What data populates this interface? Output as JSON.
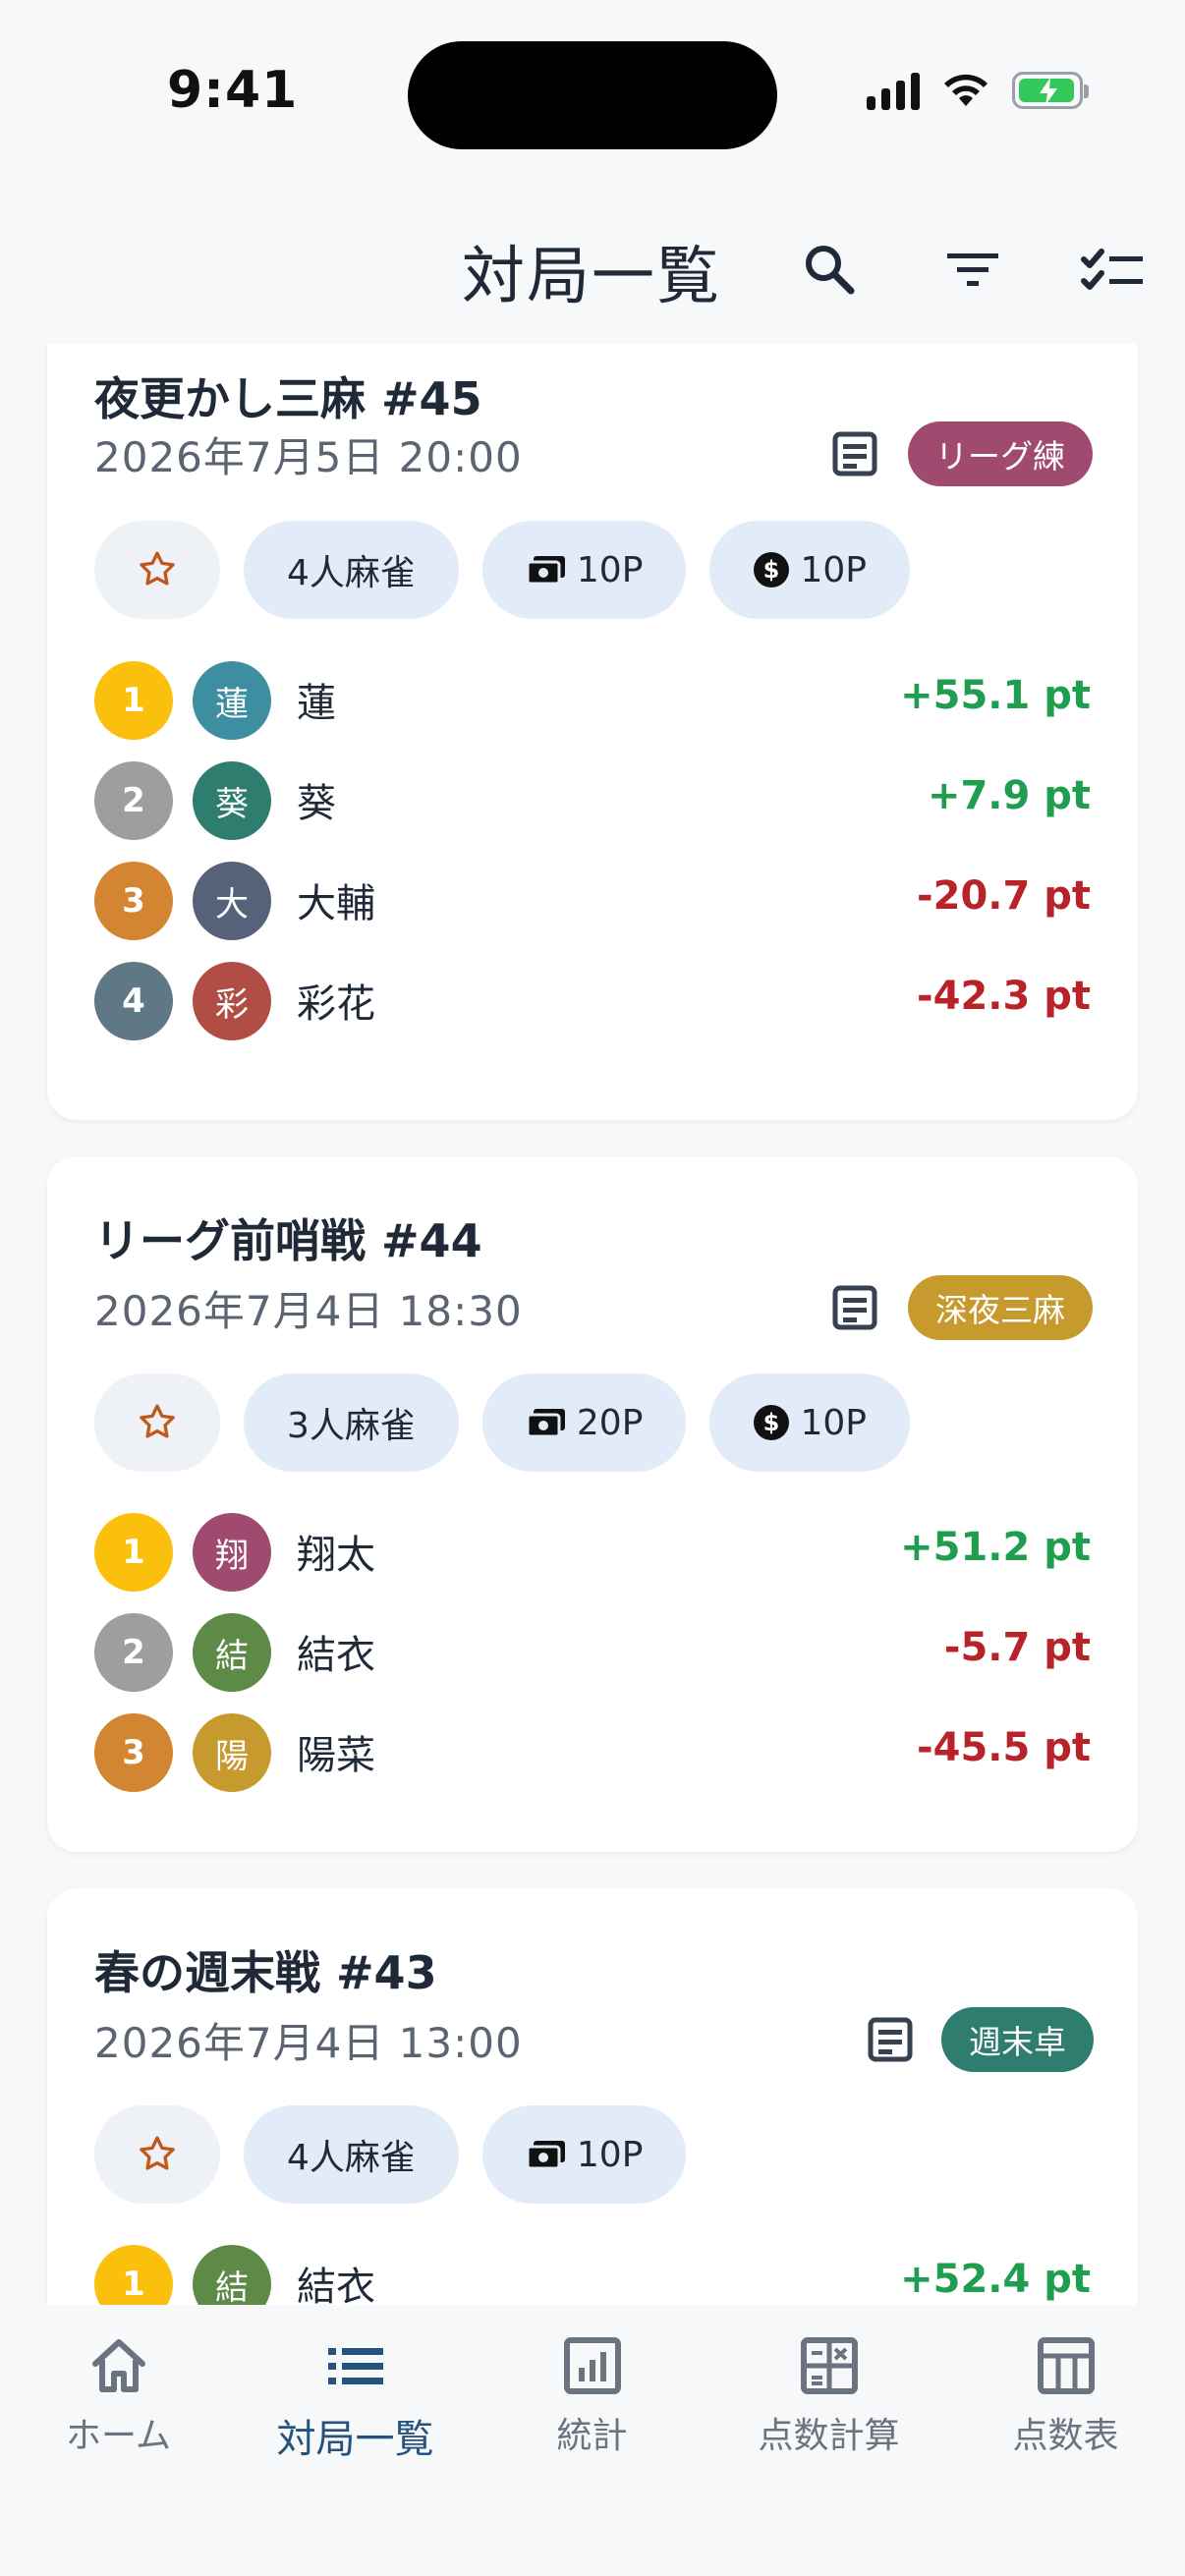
{
  "status": {
    "time": "9:41"
  },
  "header": {
    "title": "対局一覧"
  },
  "games": [
    {
      "title": "夜更かし三麻 #45",
      "date": "2026年7月5日 20:00",
      "tag": "リーグ練",
      "tag_color": "#a14a6f",
      "chips": {
        "players": "4人麻雀",
        "rate": "10P",
        "chip": "10P"
      },
      "results": [
        {
          "rank": "1",
          "avatar": "蓮",
          "avatar_color": "#3d8ea0",
          "name": "蓮",
          "score": "+55.1 pt"
        },
        {
          "rank": "2",
          "avatar": "葵",
          "avatar_color": "#2e7d6e",
          "name": "葵",
          "score": "+7.9 pt"
        },
        {
          "rank": "3",
          "avatar": "大",
          "avatar_color": "#56627a",
          "name": "大輔",
          "score": "-20.7 pt"
        },
        {
          "rank": "4",
          "avatar": "彩",
          "avatar_color": "#b04e45",
          "name": "彩花",
          "score": "-42.3 pt"
        }
      ]
    },
    {
      "title": "リーグ前哨戦 #44",
      "date": "2026年7月4日 18:30",
      "tag": "深夜三麻",
      "tag_color": "#c79a2e",
      "chips": {
        "players": "3人麻雀",
        "rate": "20P",
        "chip": "10P"
      },
      "results": [
        {
          "rank": "1",
          "avatar": "翔",
          "avatar_color": "#a14a6f",
          "name": "翔太",
          "score": "+51.2 pt"
        },
        {
          "rank": "2",
          "avatar": "結",
          "avatar_color": "#5e8a48",
          "name": "結衣",
          "score": "-5.7 pt"
        },
        {
          "rank": "3",
          "avatar": "陽",
          "avatar_color": "#c79a2e",
          "name": "陽菜",
          "score": "-45.5 pt"
        }
      ]
    },
    {
      "title": "春の週末戦 #43",
      "date": "2026年7月4日 13:00",
      "tag": "週末卓",
      "tag_color": "#2e7d6e",
      "chips": {
        "players": "4人麻雀",
        "rate": "10P"
      },
      "results": [
        {
          "rank": "1",
          "avatar": "結",
          "avatar_color": "#5e8a48",
          "name": "結衣",
          "score": "+52.4 pt"
        }
      ]
    }
  ],
  "rank_colors": {
    "1": "#fbbf0e",
    "2": "#9e9e9e",
    "3": "#d38531",
    "4": "#5f7886"
  },
  "nav": [
    {
      "label": "ホーム",
      "icon": "home-icon"
    },
    {
      "label": "対局一覧",
      "icon": "list-icon"
    },
    {
      "label": "統計",
      "icon": "chart-icon"
    },
    {
      "label": "点数計算",
      "icon": "calculator-icon"
    },
    {
      "label": "点数表",
      "icon": "table-icon"
    }
  ]
}
